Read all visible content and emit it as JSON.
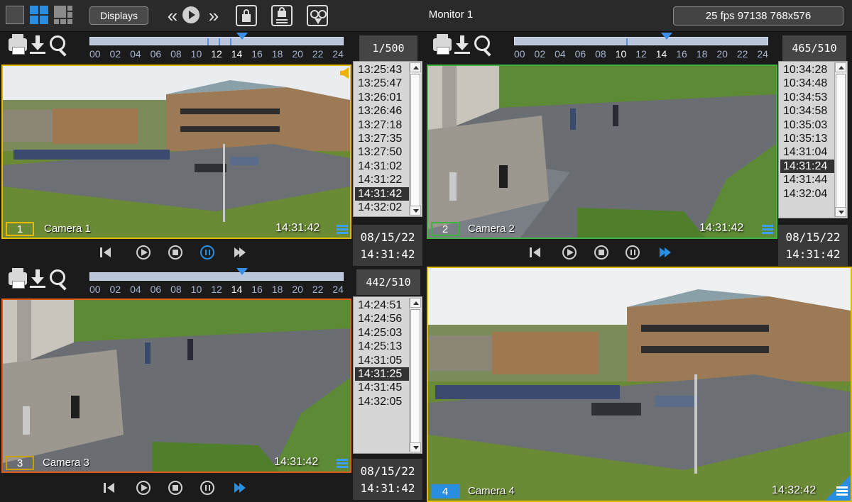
{
  "toolbar": {
    "displays_label": "Displays",
    "monitor_title": "Monitor 1",
    "status": "25 fps  97138 768x576"
  },
  "timeline_hours": [
    "00",
    "02",
    "04",
    "06",
    "08",
    "10",
    "12",
    "14",
    "16",
    "18",
    "20",
    "22",
    "24"
  ],
  "cameras": [
    {
      "number": "1",
      "name": "Camera 1",
      "time": "14:31:42",
      "counter": "1/500",
      "date": "08/15/22",
      "datetime_time": "14:31:42",
      "border_color": "#e6b800",
      "times": [
        "13:25:43",
        "13:25:47",
        "13:26:01",
        "13:26:46",
        "13:27:18",
        "13:27:35",
        "13:27:50",
        "14:31:02",
        "14:31:22",
        "14:31:42",
        "14:32:02"
      ],
      "selected_time": "14:31:42",
      "timeline_position": "14:00"
    },
    {
      "number": "2",
      "name": "Camera 2",
      "time": "14:31:42",
      "counter": "465/510",
      "date": "08/15/22",
      "datetime_time": "14:31:42",
      "border_color": "#3fb23f",
      "times": [
        "10:34:28",
        "10:34:48",
        "10:34:53",
        "10:34:58",
        "10:35:03",
        "10:35:13",
        "14:31:04",
        "14:31:24",
        "14:31:44",
        "14:32:04"
      ],
      "selected_time": "14:31:24",
      "timeline_position": "14:00"
    },
    {
      "number": "3",
      "name": "Camera 3",
      "time": "14:31:42",
      "counter": "442/510",
      "date": "08/15/22",
      "datetime_time": "14:31:42",
      "border_color": "#e05a1a",
      "times": [
        "14:24:51",
        "14:24:56",
        "14:25:03",
        "14:25:13",
        "14:31:05",
        "14:31:25",
        "14:31:45",
        "14:32:05"
      ],
      "selected_time": "14:31:25",
      "timeline_position": "14:00"
    },
    {
      "number": "4",
      "name": "Camera 4",
      "time": "14:32:42",
      "border_color": "#e6b800",
      "number_bg": "#2a8ee0"
    }
  ],
  "colors": {
    "accent": "#2a8ee0",
    "active_control": "#2a8ee0"
  }
}
